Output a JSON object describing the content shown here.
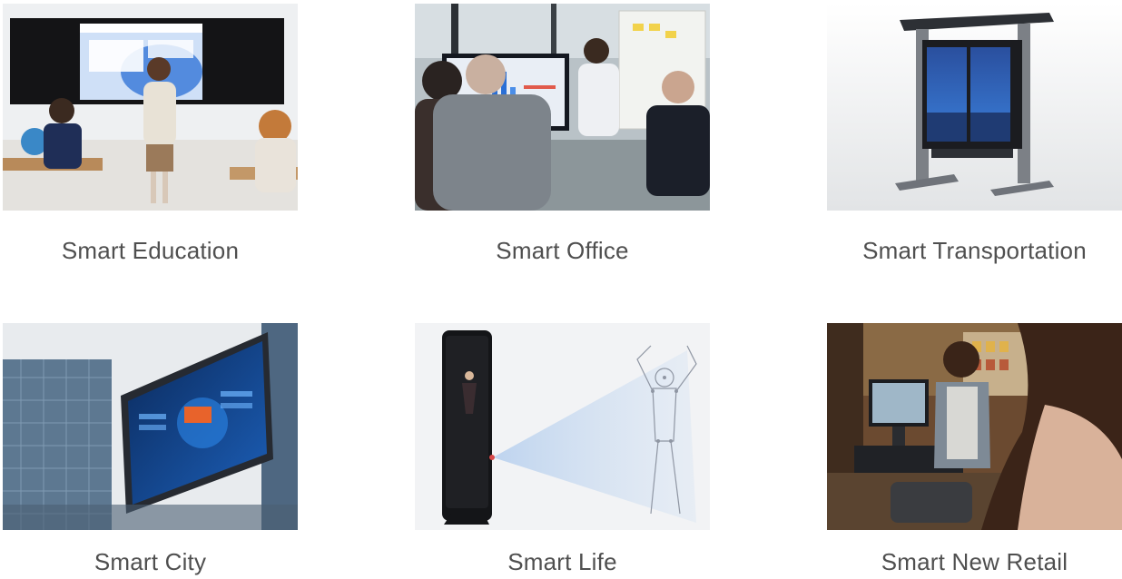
{
  "scenarios": [
    {
      "label": "Smart Education",
      "image": "classroom-interactive-whiteboard-image"
    },
    {
      "label": "Smart Office",
      "image": "office-meeting-display-image"
    },
    {
      "label": "Smart Transportation",
      "image": "outdoor-bus-stop-kiosk-image"
    },
    {
      "label": "Smart City",
      "image": "building-led-billboard-image"
    },
    {
      "label": "Smart Life",
      "image": "smart-fitness-mirror-image"
    },
    {
      "label": "Smart New Retail",
      "image": "retail-pos-checkout-image"
    }
  ],
  "colors": {
    "label_text": "#4f4f4f",
    "background": "#ffffff",
    "screen_blue": "#2a6fd6",
    "dark_panel": "#1d1f24"
  }
}
